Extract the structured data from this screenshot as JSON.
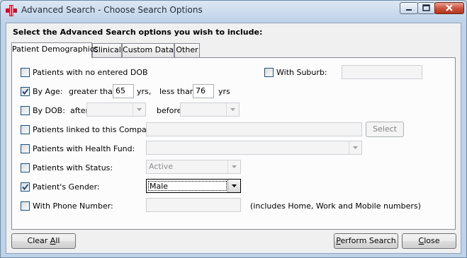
{
  "window": {
    "title": "Advanced Search - Choose Search Options"
  },
  "heading": "Select the Advanced Search options you wish to include:",
  "tabs": [
    {
      "label": "Patient Demographics",
      "active": true
    },
    {
      "label": "Clinical",
      "active": false
    },
    {
      "label": "Custom Data",
      "active": false
    },
    {
      "label": "Other",
      "active": false
    }
  ],
  "options": {
    "no_dob": {
      "label": "Patients with no entered DOB",
      "checked": false
    },
    "suburb": {
      "label": "With Suburb:",
      "checked": false,
      "value": ""
    },
    "by_age": {
      "label": "By Age:",
      "checked": true,
      "greater_than_label": "greater than",
      "greater_than_value": "65",
      "yrs1": "yrs,",
      "less_than_label": "less than",
      "less_than_value": "76",
      "yrs2": "yrs"
    },
    "by_dob": {
      "label": "By DOB:",
      "checked": false,
      "after_label": "after",
      "after_value": "",
      "before_label": "before",
      "before_value": ""
    },
    "company": {
      "label": "Patients linked to this Company:",
      "checked": false,
      "value": "",
      "select_label": "Select"
    },
    "health_fund": {
      "label": "Patients with Health Fund:",
      "checked": false,
      "value": ""
    },
    "status": {
      "label": "Patients with Status:",
      "checked": false,
      "value": "Active"
    },
    "gender": {
      "label": "Patient's Gender:",
      "checked": true,
      "value": "Male"
    },
    "phone": {
      "label": "With Phone Number:",
      "checked": false,
      "value": "",
      "note": "(includes Home, Work and Mobile numbers)"
    }
  },
  "buttons": {
    "clear_all_pre": "Clear ",
    "clear_all_ul": "A",
    "clear_all_post": "ll",
    "perform_ul": "P",
    "perform_post": "erform Search",
    "close_ul": "C",
    "close_post": "lose"
  },
  "colors": {
    "title_bar": "#bfd2e8",
    "close_button": "#c8503a",
    "app_icon": "#c8102e"
  }
}
